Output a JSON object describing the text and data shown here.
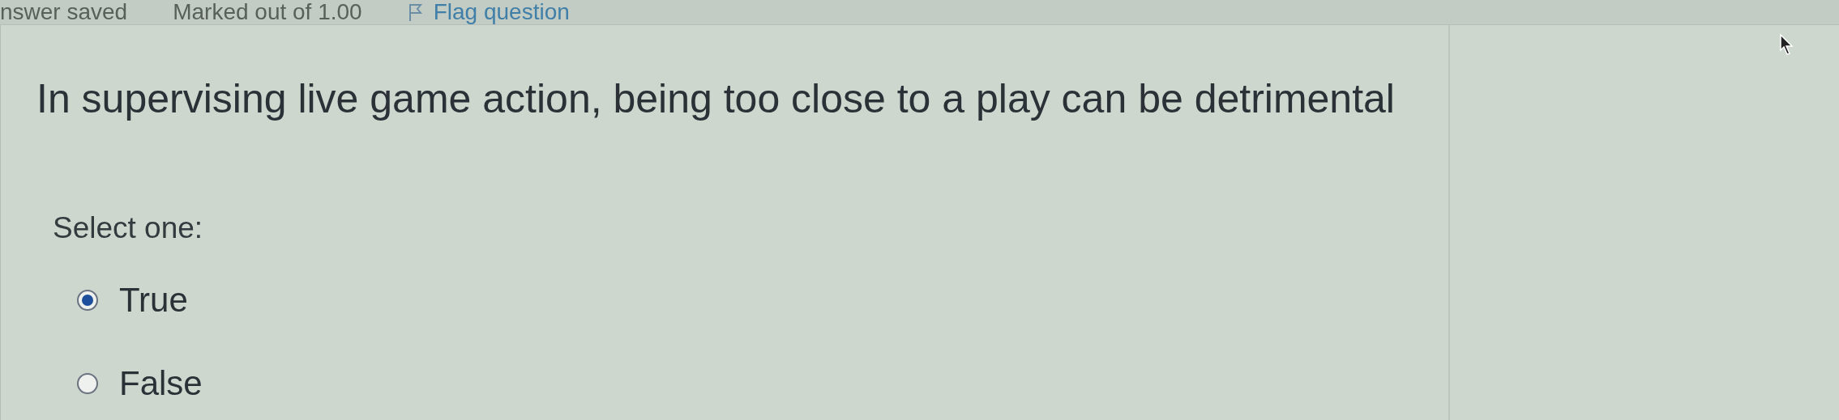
{
  "status": {
    "answer_state": "nswer saved",
    "marks": "Marked out of 1.00",
    "flag": "Flag question"
  },
  "question": "In supervising live game action, being too close to a play can be detrimental",
  "prompt": "Select one:",
  "options": [
    {
      "label": "True",
      "selected": true
    },
    {
      "label": "False",
      "selected": false
    }
  ]
}
